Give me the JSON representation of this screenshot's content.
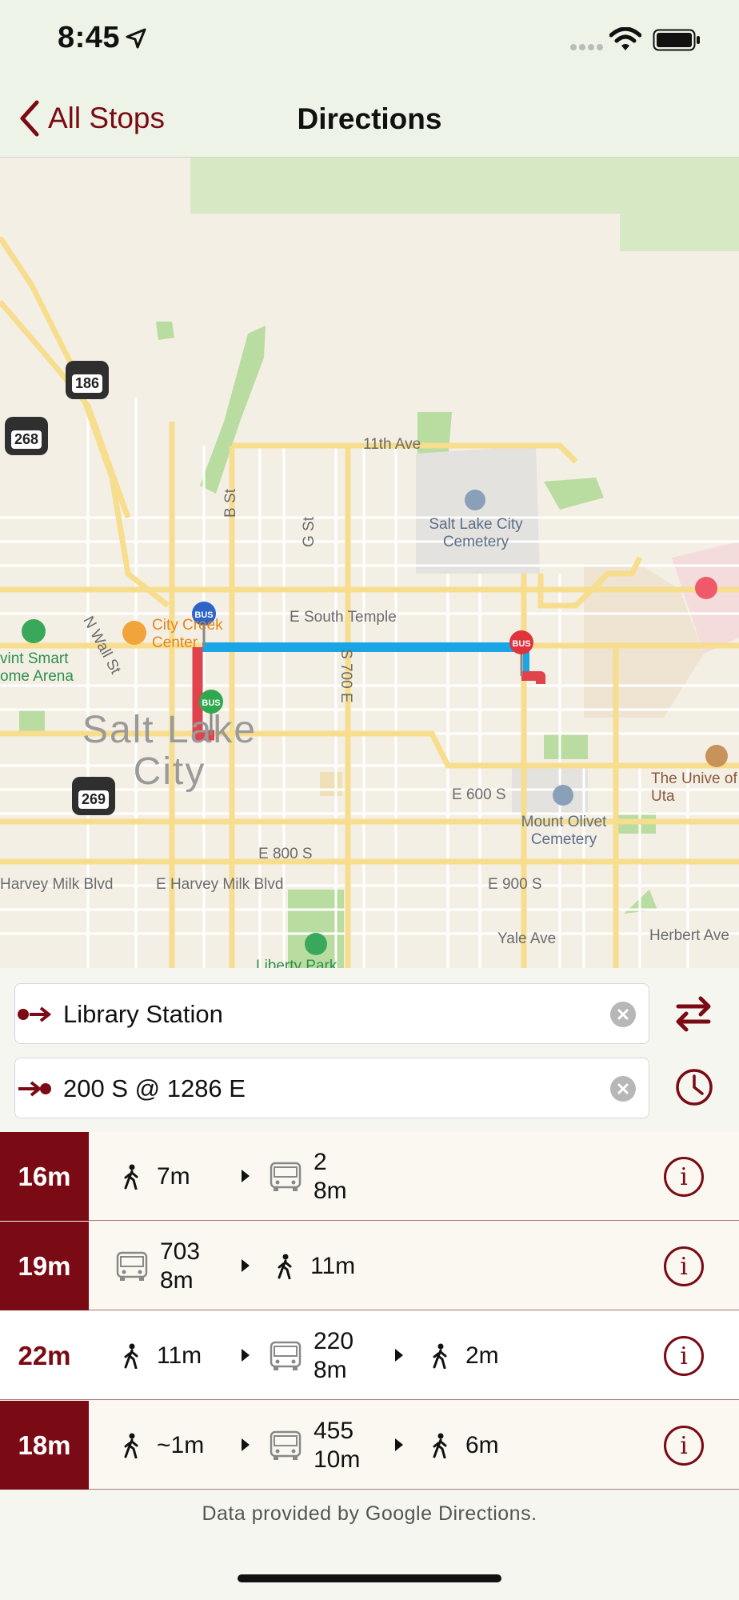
{
  "status_bar": {
    "time": "8:45"
  },
  "nav": {
    "back_label": "All Stops",
    "title": "Directions"
  },
  "map": {
    "city_name": "Salt Lake City",
    "streets": [
      "11th Ave",
      "N Wall St",
      "B St",
      "G St",
      "E South Temple",
      "S 700 E",
      "E 600 S",
      "E 800 S",
      "E Harvey Milk Blvd",
      "Harvey Milk Blvd",
      "E 900 S",
      "Yale Ave",
      "Herbert Ave"
    ],
    "places": {
      "cemetery": "Salt Lake City Cemetery",
      "olivet": "Mount Olivet Cemetery",
      "city_creek": "City Creek Center",
      "arena": "vint Smart ome Arena",
      "university": "The Unive of Uta",
      "park": "Liberty Park"
    },
    "shields": [
      "186",
      "268",
      "269"
    ],
    "pins": [
      "BUS",
      "BUS",
      "BUS"
    ]
  },
  "inputs": {
    "origin": "Library Station",
    "destination": "200 S @ 1286 E"
  },
  "results": [
    {
      "duration": "16m",
      "segments": [
        {
          "type": "walk",
          "text": "7m"
        },
        {
          "type": "bus",
          "route": "2",
          "time": "8m"
        }
      ]
    },
    {
      "duration": "19m",
      "segments": [
        {
          "type": "bus",
          "route": "703",
          "time": "8m"
        },
        {
          "type": "walk",
          "text": "11m"
        }
      ]
    },
    {
      "duration": "22m",
      "segments": [
        {
          "type": "walk",
          "text": "11m"
        },
        {
          "type": "bus",
          "route": "220",
          "time": "8m"
        },
        {
          "type": "walk",
          "text": "2m"
        }
      ]
    },
    {
      "duration": "18m",
      "segments": [
        {
          "type": "walk",
          "text": "~1m"
        },
        {
          "type": "bus",
          "route": "455",
          "time": "10m"
        },
        {
          "type": "walk",
          "text": "6m"
        }
      ]
    }
  ],
  "footer": "Data provided by Google Directions.",
  "icons": [
    "location-arrow-icon",
    "wifi-icon",
    "battery-icon",
    "chevron-left-icon",
    "swap-icon",
    "clock-icon",
    "clear-icon",
    "walk-icon",
    "bus-icon",
    "play-arrow-icon",
    "info-icon"
  ],
  "colors": {
    "accent": "#7a0a14",
    "route_blue": "#1aa6e6",
    "route_red": "#e0434c"
  }
}
